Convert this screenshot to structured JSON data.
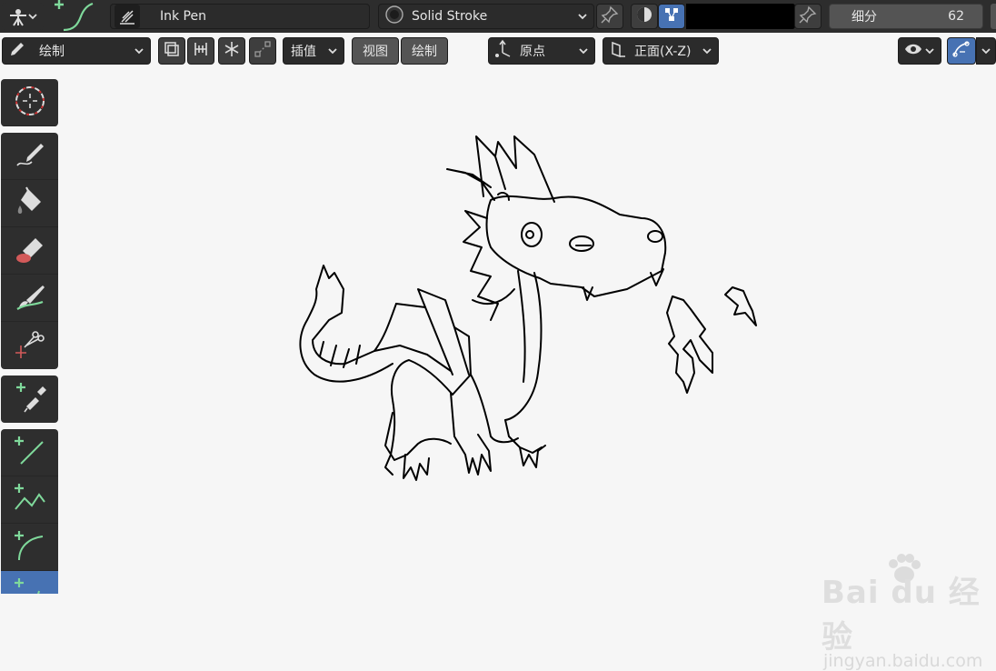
{
  "header": {
    "brush_name": "Ink Pen",
    "stroke_material": "Solid Stroke",
    "subdivision_label": "细分",
    "subdivision_value": "62",
    "color_swatch": "#000000"
  },
  "toolbar2": {
    "mode": "绘制",
    "interpolate_label": "插值",
    "view_label": "视图",
    "draw_label": "绘制",
    "origin_label": "原点",
    "plane_label": "正面(X-Z)"
  },
  "tools": [
    {
      "name": "cursor",
      "icon": "cursor-icon"
    },
    {
      "name": "draw",
      "icon": "pencil-icon"
    },
    {
      "name": "fill",
      "icon": "fill-bucket-icon"
    },
    {
      "name": "erase",
      "icon": "eraser-icon"
    },
    {
      "name": "tint",
      "icon": "tint-brush-icon"
    },
    {
      "name": "cutter",
      "icon": "scissors-icon"
    },
    {
      "name": "eyedropper",
      "icon": "eyedropper-icon"
    },
    {
      "name": "line",
      "icon": "line-icon"
    },
    {
      "name": "polyline",
      "icon": "polyline-icon"
    },
    {
      "name": "arc",
      "icon": "arc-icon"
    },
    {
      "name": "curve",
      "icon": "curve-icon",
      "active": true
    }
  ],
  "watermark": {
    "brand": "Bai du 经验",
    "url": "jingyan.baidu.com"
  },
  "colors": {
    "accent": "#4772b3",
    "header_bg": "#2d2d2d",
    "canvas_bg": "#f6f6f6",
    "tool_green": "#7fd99b"
  }
}
